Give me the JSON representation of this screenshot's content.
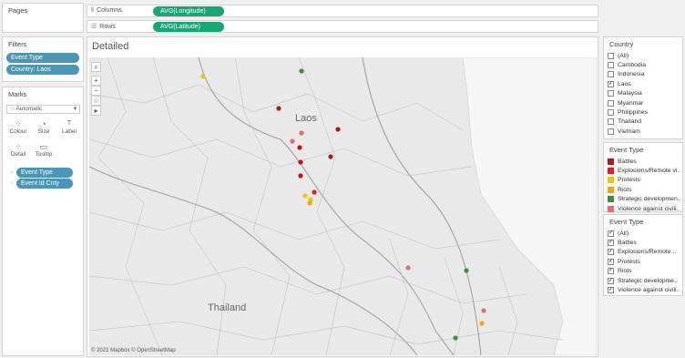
{
  "pages_title": "Pages",
  "shelves": {
    "columns_label": "Columns",
    "columns_pill": "AVG(Longitude)",
    "rows_label": "Rows",
    "rows_pill": "AVG(Latitude)"
  },
  "filters": {
    "title": "Filters",
    "items": [
      "Event Type",
      "Country: Laos"
    ]
  },
  "marks": {
    "title": "Marks",
    "type_dropdown": "Automatic",
    "buttons": {
      "colour": "Colour",
      "size": "Size",
      "label": "Label",
      "detail": "Detail",
      "tooltip": "Tooltip"
    },
    "fields": [
      "Event Type",
      "Event Id Cnty"
    ]
  },
  "view": {
    "title": "Detailed",
    "attribution": "© 2021 Mapbox © OpenStreetMap",
    "map_labels": {
      "laos": "Laos",
      "thailand": "Thailand"
    }
  },
  "country_filter": {
    "title": "Country",
    "items": [
      {
        "label": "(All)",
        "checked": false
      },
      {
        "label": "Cambodia",
        "checked": false
      },
      {
        "label": "Indonesia",
        "checked": false
      },
      {
        "label": "Laos",
        "checked": true
      },
      {
        "label": "Malaysia",
        "checked": false
      },
      {
        "label": "Myanmar",
        "checked": false
      },
      {
        "label": "Philippines",
        "checked": false
      },
      {
        "label": "Thailand",
        "checked": false
      },
      {
        "label": "Vietnam",
        "checked": false
      }
    ]
  },
  "event_legend": {
    "title": "Event Type",
    "items": [
      {
        "label": "Battles",
        "color": "#b2181b"
      },
      {
        "label": "Explosions/Remote vi..",
        "color": "#e21f1f"
      },
      {
        "label": "Protests",
        "color": "#e6c619"
      },
      {
        "label": "Riots",
        "color": "#f2a614"
      },
      {
        "label": "Strategic developmen..",
        "color": "#3c8f3c"
      },
      {
        "label": "Violence against civili..",
        "color": "#e96a6a"
      }
    ]
  },
  "event_filter": {
    "title": "Event Type",
    "items": [
      {
        "label": "(All)",
        "checked": true
      },
      {
        "label": "Battles",
        "checked": true
      },
      {
        "label": "Explosions/Remote ..",
        "checked": true
      },
      {
        "label": "Protests",
        "checked": true
      },
      {
        "label": "Riots",
        "checked": true
      },
      {
        "label": "Strategic developme..",
        "checked": true
      },
      {
        "label": "Violence against civili..",
        "checked": true
      }
    ]
  }
}
